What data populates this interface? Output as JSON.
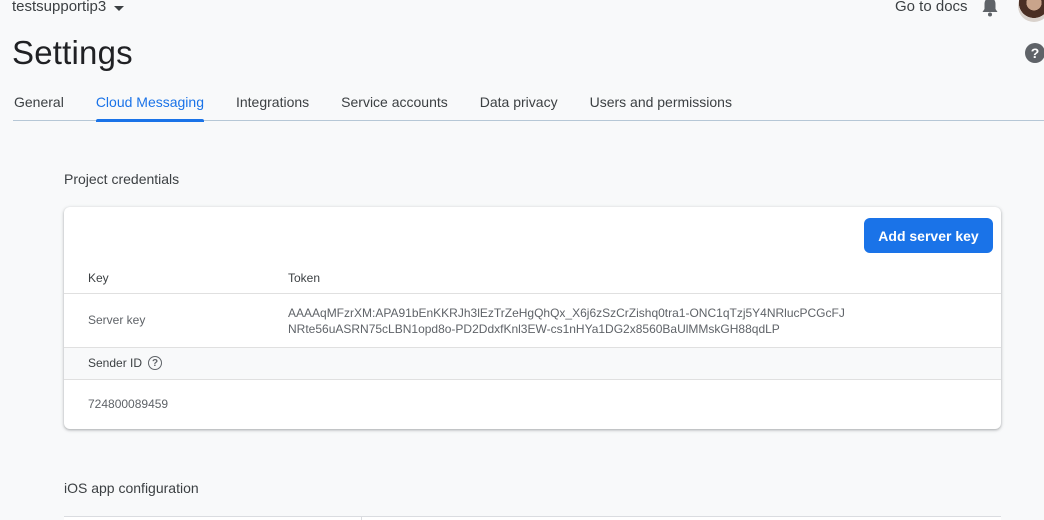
{
  "topbar": {
    "project_name": "testsupportip3",
    "docs_link": "Go to docs"
  },
  "page": {
    "title": "Settings"
  },
  "tabs": [
    {
      "label": "General"
    },
    {
      "label": "Cloud Messaging",
      "active": true
    },
    {
      "label": "Integrations"
    },
    {
      "label": "Service accounts"
    },
    {
      "label": "Data privacy"
    },
    {
      "label": "Users and permissions"
    }
  ],
  "project_credentials": {
    "title": "Project credentials",
    "add_button": "Add server key",
    "columns": {
      "key": "Key",
      "token": "Token"
    },
    "server_key_label": "Server key",
    "token_line1": "AAAAqMFzrXM:APA91bEnKKRJh3lEzTrZeHgQhQx_X6j6zSzCrZishq0tra1-ONC1qTzj5Y4NRlucPCGcFJ",
    "token_line2": "NRte56uASRN75cLBN1opd8o-PD2DdxfKnl3EW-cs1nHYa1DG2x8560BaUlMMskGH88qdLP",
    "sender_id_label": "Sender ID",
    "sender_id_value": "724800089459"
  },
  "ios_section": {
    "title": "iOS app configuration"
  },
  "colors": {
    "accent": "#1a73e8",
    "background": "#f8f9fa"
  }
}
